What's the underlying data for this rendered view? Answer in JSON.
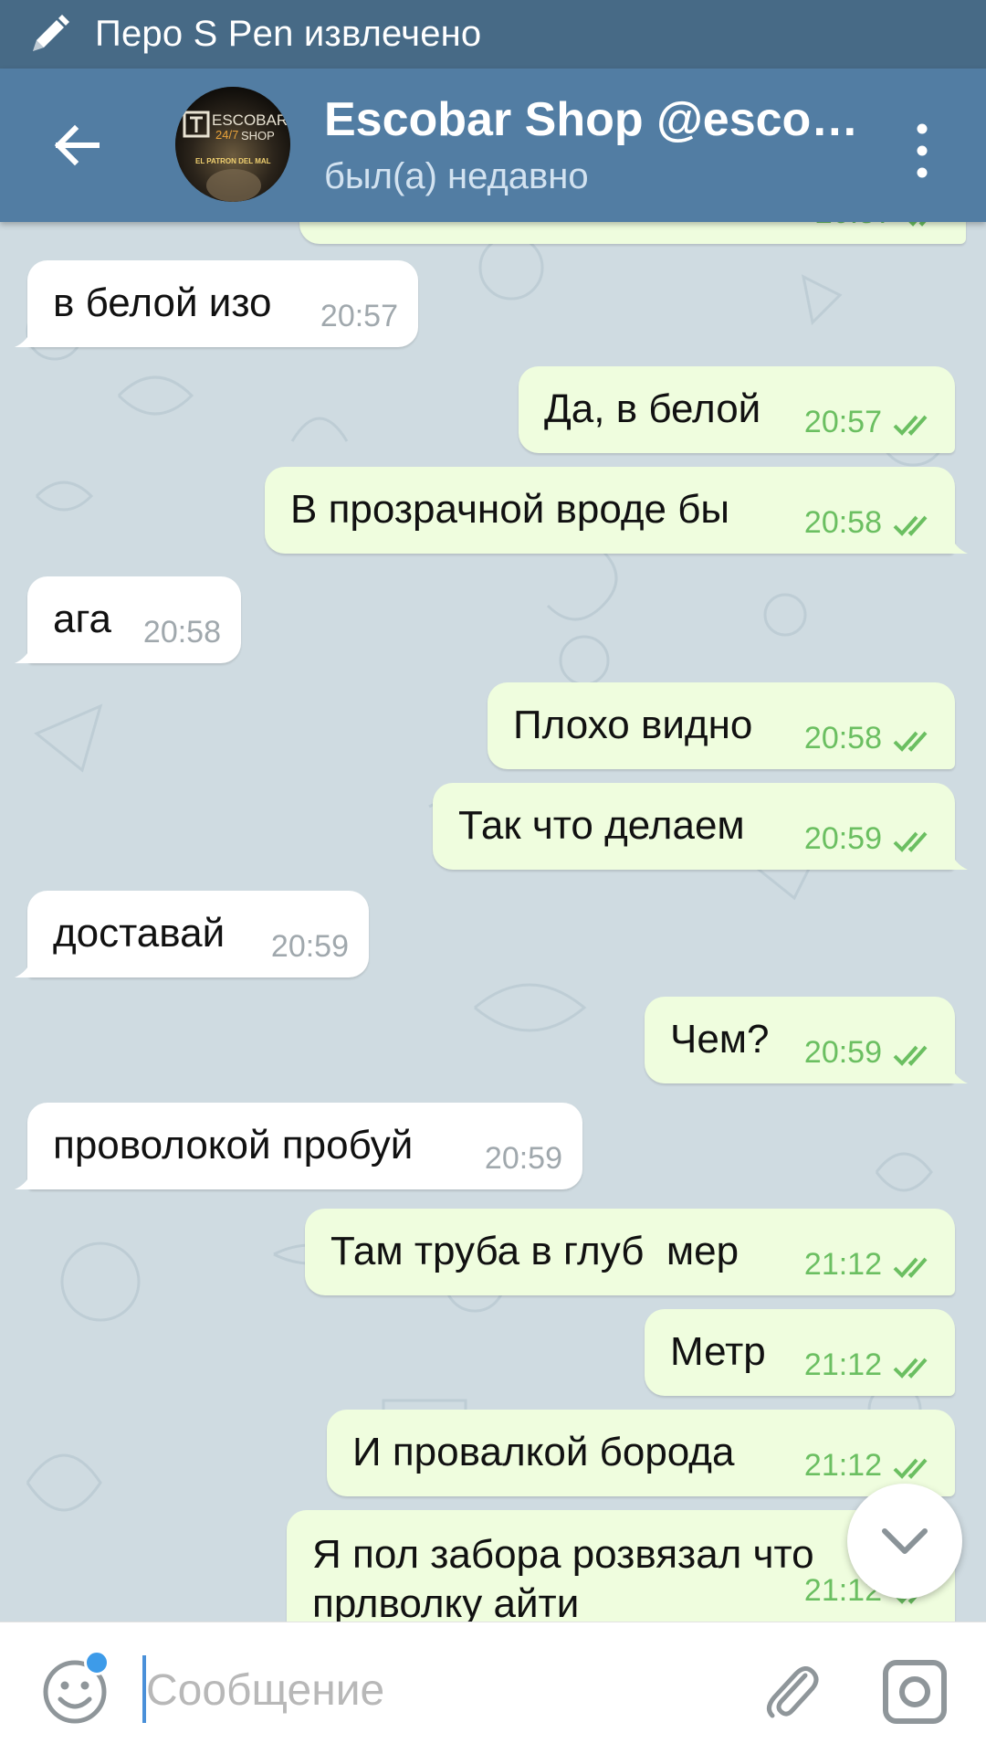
{
  "status_bar": {
    "icon": "pen-icon",
    "text": "Перо S Pen извлечено"
  },
  "header": {
    "back_icon": "arrow-left-icon",
    "avatar_text": [
      "ESCOBAR",
      "24/7",
      "SHOP",
      "EL PATRON DEL MAL"
    ],
    "title": "Escobar Shop @escob…",
    "subtitle": "был(а) недавно",
    "menu_icon": "more-vertical-icon"
  },
  "messages": [
    {
      "dir": "out",
      "text": "",
      "time": "20:57",
      "partial": true
    },
    {
      "dir": "in",
      "text": "в белой изо",
      "time": "20:57"
    },
    {
      "dir": "out",
      "text": "Да, в белой",
      "time": "20:57"
    },
    {
      "dir": "out",
      "text": "В прозрачной вроде бы",
      "time": "20:58"
    },
    {
      "dir": "in",
      "text": "ага",
      "time": "20:58"
    },
    {
      "dir": "out",
      "text": "Плохо видно",
      "time": "20:58"
    },
    {
      "dir": "out",
      "text": "Так что делаем",
      "time": "20:59"
    },
    {
      "dir": "in",
      "text": "доставай",
      "time": "20:59"
    },
    {
      "dir": "out",
      "text": "Чем?",
      "time": "20:59"
    },
    {
      "dir": "in",
      "text": "проволокой пробуй",
      "time": "20:59"
    },
    {
      "dir": "out",
      "text": "Там труба в глуб  мер",
      "time": "21:12"
    },
    {
      "dir": "out",
      "text": "Метр",
      "time": "21:12"
    },
    {
      "dir": "out",
      "text": "И провалкой борода",
      "time": "21:12"
    },
    {
      "dir": "out",
      "text": "Я пол забора розвязал что прлволку айти",
      "time": "21:12",
      "partial": true
    }
  ],
  "scroll_down_icon": "chevron-down-icon",
  "input": {
    "placeholder": "Сообщение",
    "emoji_icon": "smiley-icon",
    "attach_icon": "paperclip-icon",
    "camera_icon": "camera-icon"
  },
  "colors": {
    "status_bar": "#476a86",
    "header": "#527da3",
    "outgoing_bubble": "#effdde",
    "incoming_bubble": "#ffffff",
    "read_check": "#6bbf61",
    "chat_bg": "#cfdbe1"
  }
}
